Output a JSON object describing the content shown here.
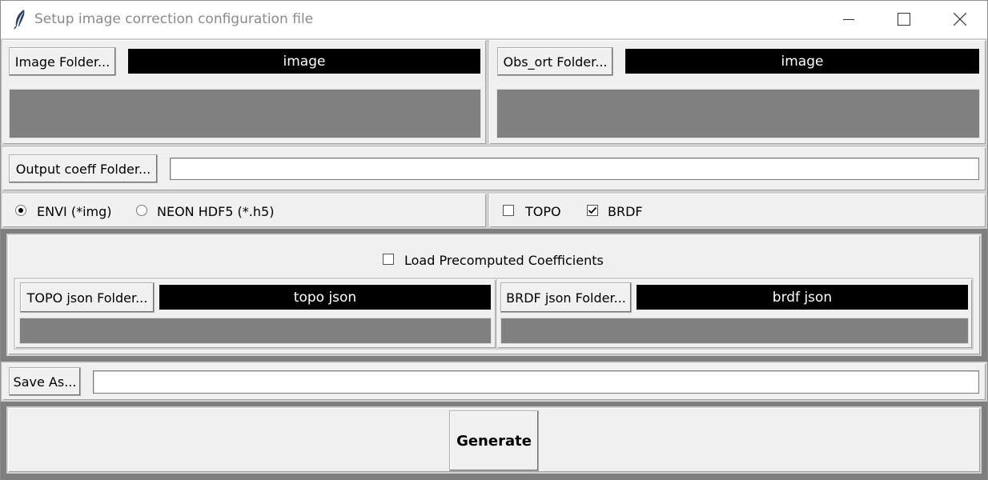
{
  "window": {
    "title": "Setup image correction configuration file",
    "minimize_icon": "minimize-icon",
    "maximize_icon": "maximize-icon",
    "close_icon": "close-icon",
    "app_icon": "feather-icon"
  },
  "image_panel": {
    "button_label": "Image Folder...",
    "path_text": "image"
  },
  "obs_panel": {
    "button_label": "Obs_ort Folder...",
    "path_text": "image"
  },
  "output_coeff": {
    "button_label": "Output coeff Folder...",
    "value": ""
  },
  "format": {
    "options": [
      "ENVI (*img)",
      "NEON HDF5 (*.h5)"
    ],
    "selected": "ENVI (*img)"
  },
  "corrections": {
    "topo_label": "TOPO",
    "topo_checked": false,
    "brdf_label": "BRDF",
    "brdf_checked": true
  },
  "precomputed": {
    "checkbox_label": "Load Precomputed Coefficients",
    "checked": false,
    "topo_button_label": "TOPO json Folder...",
    "topo_path_text": "topo json",
    "brdf_button_label": "BRDF json Folder...",
    "brdf_path_text": "brdf json"
  },
  "save": {
    "button_label": "Save As...",
    "value": ""
  },
  "generate": {
    "button_label": "Generate"
  },
  "colors": {
    "path_bar": "#000000",
    "placeholder_box": "#808080",
    "window_bg": "#f0f0f0"
  }
}
